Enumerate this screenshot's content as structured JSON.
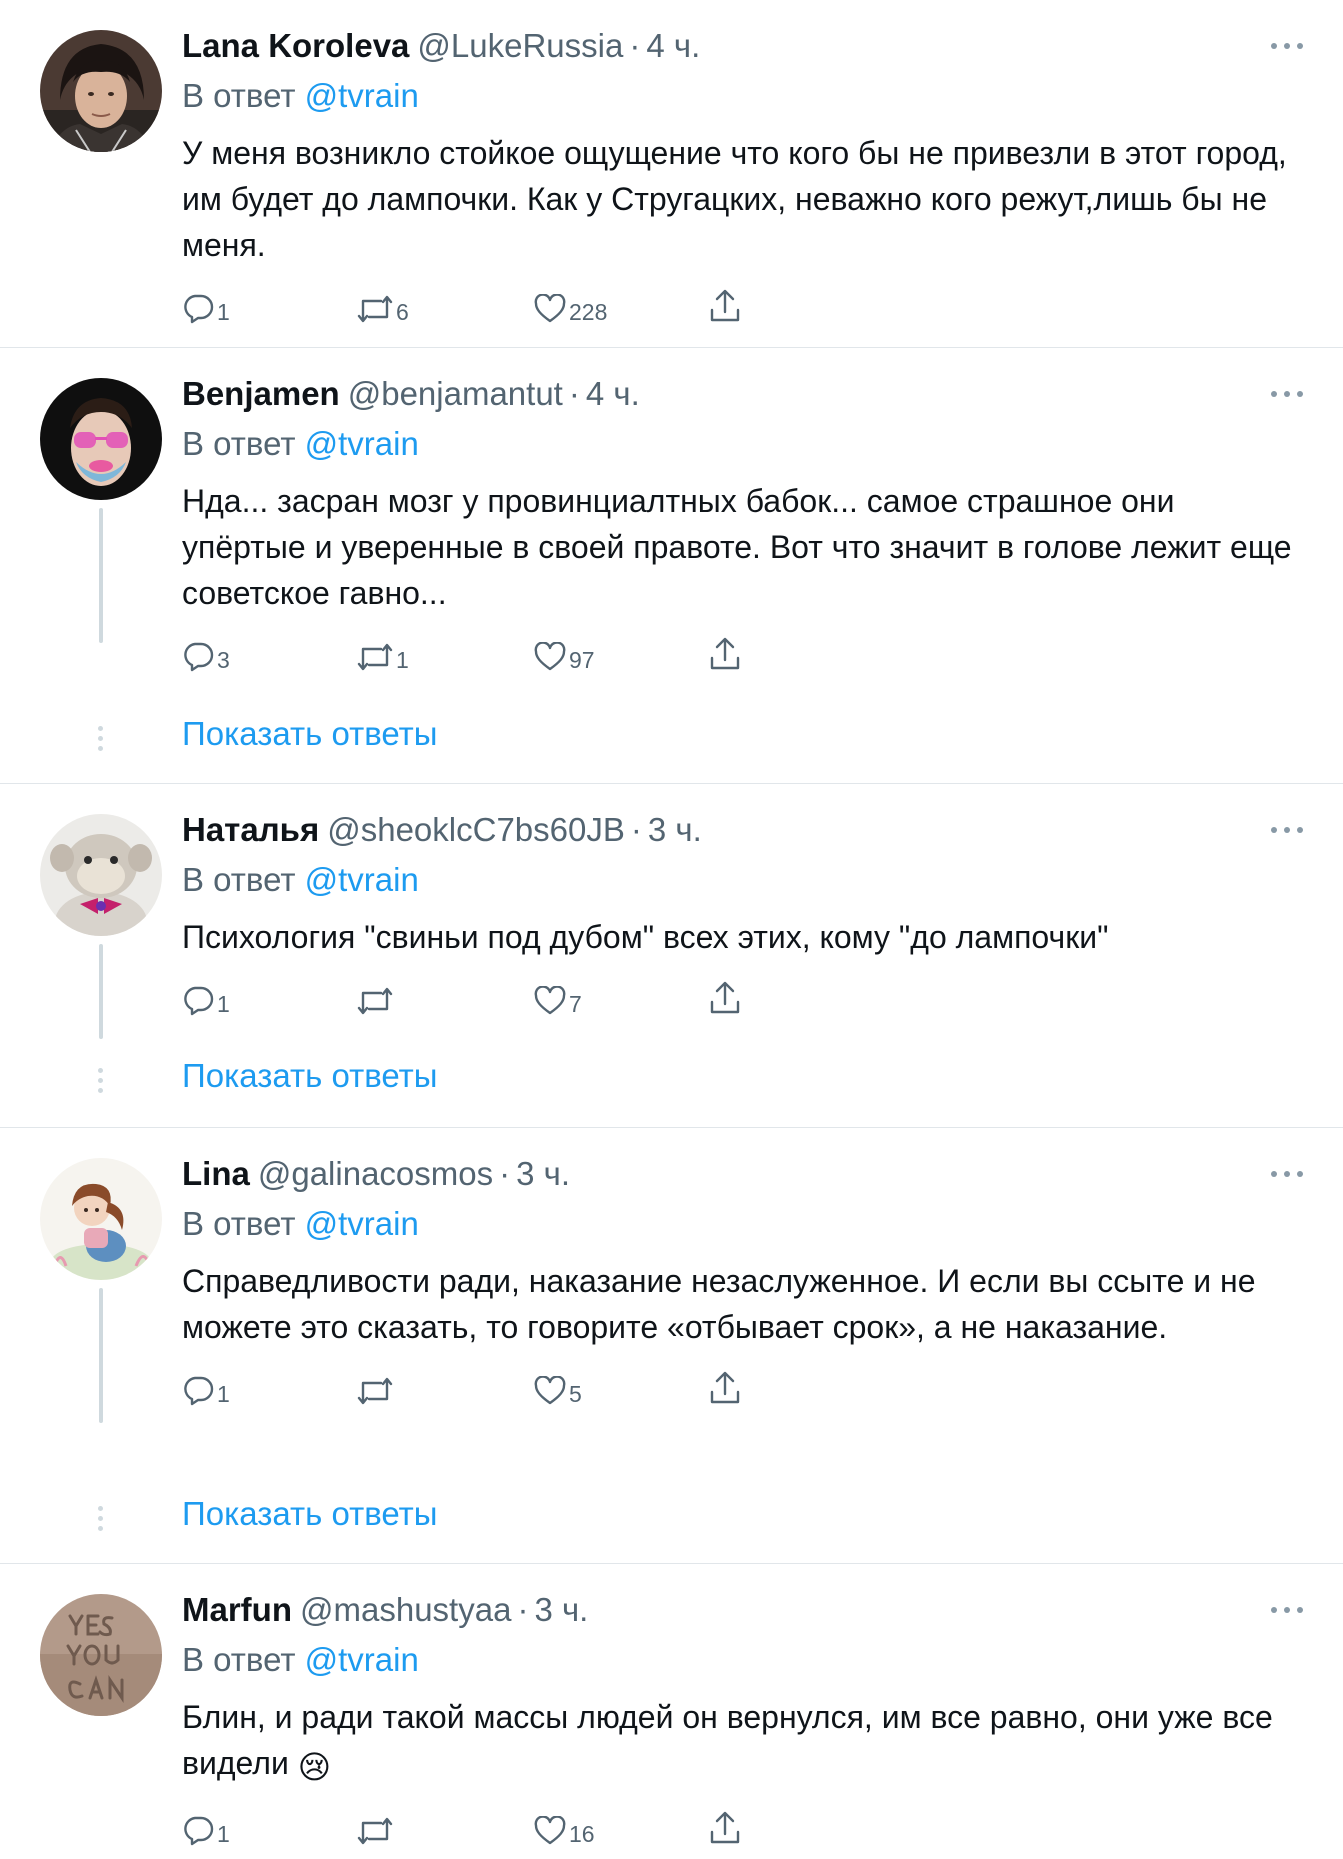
{
  "colors": {
    "accent": "#1d9bf0",
    "secondary": "#536471",
    "divider": "#e1e6ea",
    "thread": "#cfd9de"
  },
  "tweets": [
    {
      "display_name": "Lana Koroleva",
      "handle": "@LukeRussia",
      "separator": "·",
      "time": "4 ч.",
      "reply_prefix": "В ответ",
      "reply_to": "@tvrain",
      "text": "У меня возникло стойкое ощущение что кого бы не привезли в этот город, им будет до лампочки. Как у Стругацких, неважно кого режут,лишь бы не меня.",
      "replies": "1",
      "retweets": "6",
      "likes": "228",
      "avatar_icon": "avatar-dark-hair-man"
    },
    {
      "display_name": "Benjamen",
      "handle": "@benjamantut",
      "separator": "·",
      "time": "4 ч.",
      "reply_prefix": "В ответ",
      "reply_to": "@tvrain",
      "text": "Нда... засран мозг у провинциалтных бабок... самое страшное они упёртые и уверенные в своей правоте. Вот что значит в голове лежит еще советское гавно...",
      "replies": "3",
      "retweets": "1",
      "likes": "97",
      "show_replies": "Показать ответы",
      "avatar_icon": "avatar-pink-glasses"
    },
    {
      "display_name": "Наталья",
      "handle": "@sheoklcC7bs60JB",
      "separator": "·",
      "time": "3 ч.",
      "reply_prefix": "В ответ",
      "reply_to": "@tvrain",
      "text": "Психология \"свиньи под дубом\" всех этих, кому \"до лампочки\"",
      "replies": "1",
      "retweets": "",
      "likes": "7",
      "show_replies": "Показать ответы",
      "avatar_icon": "avatar-plush-monkey"
    },
    {
      "display_name": "Lina",
      "handle": "@galinacosmos",
      "separator": "·",
      "time": "3 ч.",
      "reply_prefix": "В ответ",
      "reply_to": "@tvrain",
      "text": "Справедливости ради, наказание незаслуженное. И если вы ссыте и не можете это сказать, то говорите «отбывает срок», а не наказание.",
      "replies": "1",
      "retweets": "",
      "likes": "5",
      "show_replies": "Показать ответы",
      "avatar_icon": "avatar-girl-illustration"
    },
    {
      "display_name": "Marfun",
      "handle": "@mashustyaa",
      "separator": "·",
      "time": "3 ч.",
      "reply_prefix": "В ответ",
      "reply_to": "@tvrain",
      "text": "Блин, и ради такой массы людей он вернулся, им все равно, они уже все видели",
      "emoji": "😢",
      "replies": "1",
      "retweets": "",
      "likes": "16",
      "avatar_icon": "avatar-yes-you-can-sand"
    }
  ]
}
